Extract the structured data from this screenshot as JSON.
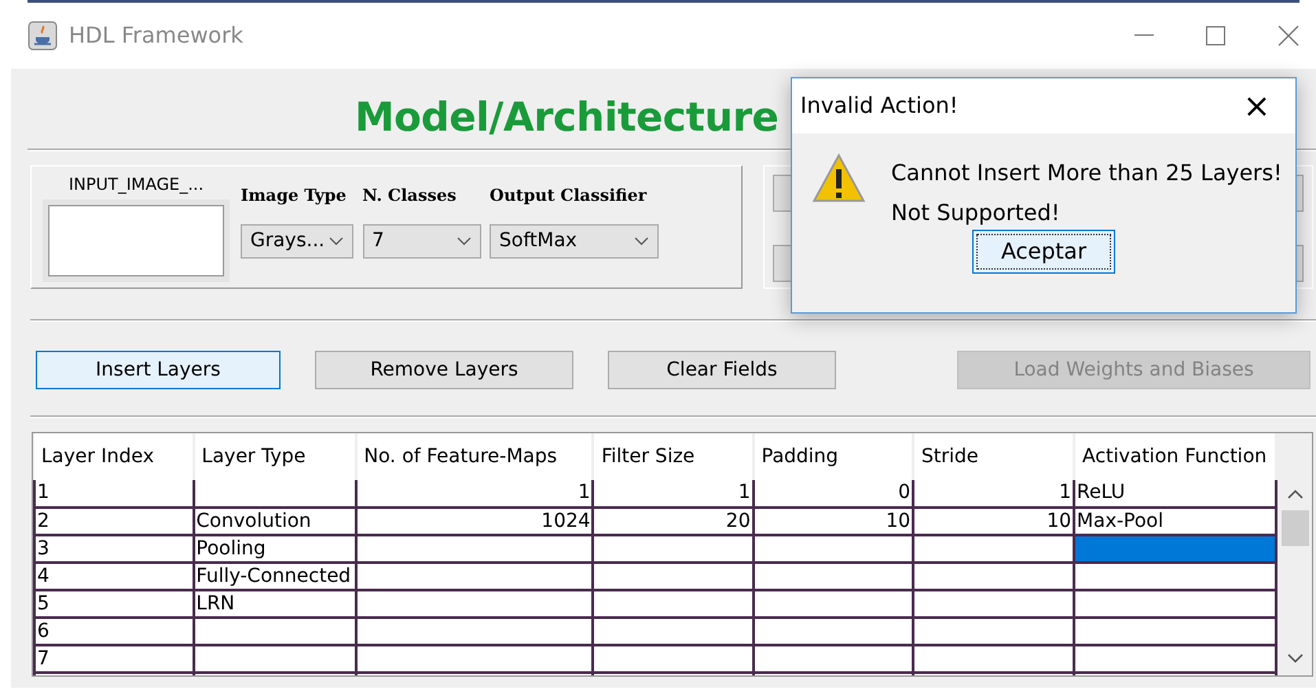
{
  "window": {
    "title": "HDL Framework"
  },
  "heading": "Model/Architecture",
  "input_image": {
    "label": "INPUT_IMAGE_..."
  },
  "selectors": [
    {
      "label": "Image Type",
      "value": "Grays..."
    },
    {
      "label": "N. Classes",
      "value": "7"
    },
    {
      "label": "Output Classifier",
      "value": "SoftMax"
    }
  ],
  "buttons": [
    {
      "label": "Insert  Layers",
      "focused": true,
      "disabled": false
    },
    {
      "label": "Remove Layers",
      "focused": false,
      "disabled": false
    },
    {
      "label": "Clear Fields",
      "focused": false,
      "disabled": false
    },
    {
      "label": "Load Weights and Biases",
      "focused": false,
      "disabled": true
    }
  ],
  "table": {
    "columns": [
      {
        "label": "Layer Index",
        "numeric": false
      },
      {
        "label": "Layer Type",
        "numeric": false
      },
      {
        "label": "No. of Feature-Maps",
        "numeric": true
      },
      {
        "label": "Filter Size",
        "numeric": true
      },
      {
        "label": "Padding",
        "numeric": true
      },
      {
        "label": "Stride",
        "numeric": true
      },
      {
        "label": "Activation Function",
        "numeric": false
      }
    ],
    "rows": [
      {
        "cells": [
          {
            "text": "1",
            "selected": false
          },
          {
            "selected": false
          },
          {
            "text": "1",
            "selected": false
          },
          {
            "text": "1",
            "selected": false
          },
          {
            "text": "0",
            "selected": false
          },
          {
            "text": "1",
            "selected": false
          },
          {
            "text": "ReLU",
            "selected": false
          }
        ]
      },
      {
        "cells": [
          {
            "text": "2",
            "selected": false
          },
          {
            "text": "Convolution",
            "selected": false
          },
          {
            "text": "1024",
            "selected": false
          },
          {
            "text": "20",
            "selected": false
          },
          {
            "text": "10",
            "selected": false
          },
          {
            "text": "10",
            "selected": false
          },
          {
            "text": "Max-Pool",
            "selected": false
          }
        ]
      },
      {
        "cells": [
          {
            "text": "3",
            "selected": false
          },
          {
            "text": "Pooling",
            "selected": false
          },
          {
            "selected": false
          },
          {
            "selected": false
          },
          {
            "selected": false
          },
          {
            "selected": false
          },
          {
            "selected": true
          }
        ]
      },
      {
        "cells": [
          {
            "text": "4",
            "selected": false
          },
          {
            "text": "Fully-Connected",
            "selected": false
          },
          {
            "selected": false
          },
          {
            "selected": false
          },
          {
            "selected": false
          },
          {
            "selected": false
          },
          {
            "selected": false
          }
        ]
      },
      {
        "cells": [
          {
            "text": "5",
            "selected": false
          },
          {
            "text": "LRN",
            "selected": false
          },
          {
            "selected": false
          },
          {
            "selected": false
          },
          {
            "selected": false
          },
          {
            "selected": false
          },
          {
            "selected": false
          }
        ]
      },
      {
        "cells": [
          {
            "text": "6",
            "selected": false
          },
          {
            "selected": false
          },
          {
            "selected": false
          },
          {
            "selected": false
          },
          {
            "selected": false
          },
          {
            "selected": false
          },
          {
            "selected": false
          }
        ]
      },
      {
        "cells": [
          {
            "text": "7",
            "selected": false
          },
          {
            "selected": false
          },
          {
            "selected": false
          },
          {
            "selected": false
          },
          {
            "selected": false
          },
          {
            "selected": false
          },
          {
            "selected": false
          }
        ]
      }
    ]
  },
  "dialog": {
    "title": "Invalid Action!",
    "close": "×",
    "messages": [
      "Cannot Insert More than 25 Layers!",
      "Not Supported!"
    ],
    "button": {
      "label": "Aceptar",
      "focused": true
    }
  }
}
